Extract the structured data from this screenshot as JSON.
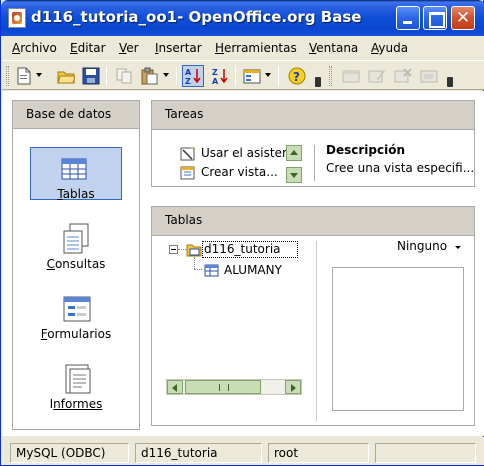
{
  "window": {
    "title": "d116_tutoria_oo1- OpenOffice.org Base",
    "close_glyph": "✕"
  },
  "menubar": {
    "items": [
      {
        "underline": "A",
        "rest": "rchivo"
      },
      {
        "underline": "E",
        "rest": "ditar"
      },
      {
        "underline": "V",
        "rest": "er"
      },
      {
        "underline": "I",
        "rest": "nsertar"
      },
      {
        "underline": "H",
        "rest": "erramientas"
      },
      {
        "underline": "V",
        "rest": "entana"
      },
      {
        "underline": "A",
        "rest": "yuda"
      }
    ]
  },
  "toolbar": {
    "icons": [
      "new-document-icon",
      "open-folder-icon",
      "save-disk-icon",
      "copy-icon",
      "paste-icon",
      "sort-ascending-icon",
      "sort-descending-icon",
      "form-icon",
      "help-icon",
      "edit-table-icon",
      "edit-icon",
      "delete-icon",
      "rename-icon"
    ]
  },
  "left_panel": {
    "header": "Base de datos",
    "items": [
      {
        "label_u": "T",
        "label_rest": "ablas",
        "icon": "tables-icon",
        "selected": true
      },
      {
        "label_u": "C",
        "label_rest": "onsultas",
        "icon": "queries-icon",
        "selected": false
      },
      {
        "label_u": "F",
        "label_rest": "ormularios",
        "icon": "forms-icon",
        "selected": false
      },
      {
        "label_u": "I",
        "label_rest": "nformes",
        "icon": "reports-icon",
        "selected": false
      }
    ]
  },
  "tareas": {
    "header": "Tareas",
    "tasks": [
      {
        "label": "Usar el asister"
      },
      {
        "label": "Crear vista..."
      }
    ],
    "description_title": "Descripción",
    "description_text": "Cree una vista especifi..."
  },
  "tablas": {
    "header": "Tablas",
    "database_node": "d116_tutoria",
    "table_node": "ALUMANY",
    "preview_mode": "Ninguno"
  },
  "statusbar": {
    "driver": "MySQL (ODBC)",
    "database": "d116_tutoria",
    "user": "root",
    "extra": ""
  },
  "colors": {
    "titlebar": "#0a46d0",
    "selection": "#c1d2ee",
    "selection_border": "#316ac5",
    "panel_header": "#d4d0c8",
    "scroll_green": "#c8dcb6"
  }
}
